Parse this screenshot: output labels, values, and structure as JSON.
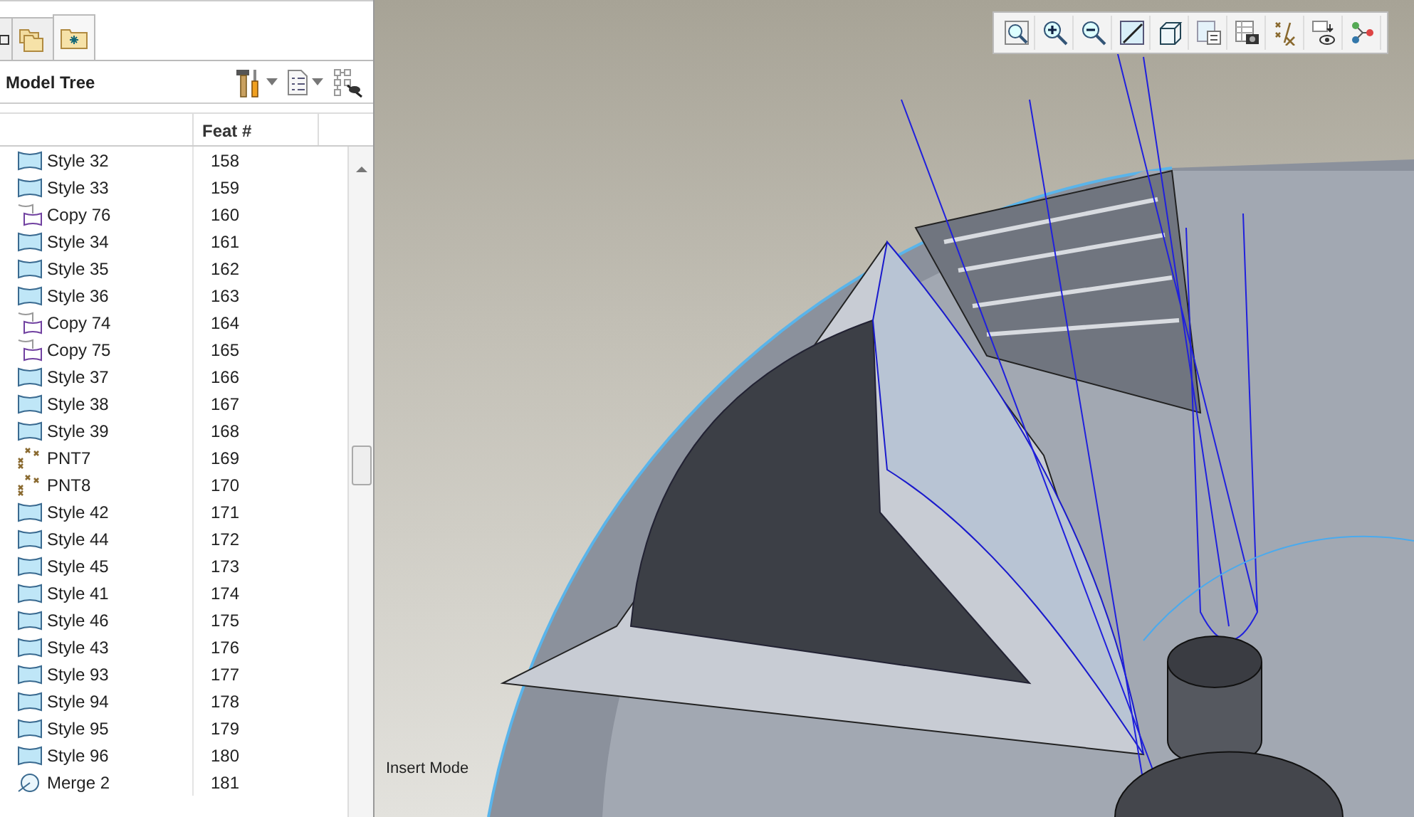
{
  "tabs": [
    {
      "kind": "tree",
      "selected": false
    },
    {
      "kind": "folders",
      "selected": false
    },
    {
      "kind": "favorites",
      "selected": true
    }
  ],
  "model_tree": {
    "title": "Model Tree",
    "columns": [
      "",
      "Feat #"
    ],
    "rows": [
      {
        "kind": "style",
        "name": "Style 32",
        "feat": "158"
      },
      {
        "kind": "style",
        "name": "Style 33",
        "feat": "159"
      },
      {
        "kind": "copy",
        "name": "Copy 76",
        "feat": "160"
      },
      {
        "kind": "style",
        "name": "Style 34",
        "feat": "161"
      },
      {
        "kind": "style",
        "name": "Style 35",
        "feat": "162"
      },
      {
        "kind": "style",
        "name": "Style 36",
        "feat": "163"
      },
      {
        "kind": "copy",
        "name": "Copy 74",
        "feat": "164"
      },
      {
        "kind": "copy",
        "name": "Copy 75",
        "feat": "165"
      },
      {
        "kind": "style",
        "name": "Style 37",
        "feat": "166"
      },
      {
        "kind": "style",
        "name": "Style 38",
        "feat": "167"
      },
      {
        "kind": "style",
        "name": "Style 39",
        "feat": "168"
      },
      {
        "kind": "point",
        "name": "PNT7",
        "feat": "169"
      },
      {
        "kind": "point",
        "name": "PNT8",
        "feat": "170"
      },
      {
        "kind": "style",
        "name": "Style 42",
        "feat": "171"
      },
      {
        "kind": "style",
        "name": "Style 44",
        "feat": "172"
      },
      {
        "kind": "style",
        "name": "Style 45",
        "feat": "173"
      },
      {
        "kind": "style",
        "name": "Style 41",
        "feat": "174"
      },
      {
        "kind": "style",
        "name": "Style 46",
        "feat": "175"
      },
      {
        "kind": "style",
        "name": "Style 43",
        "feat": "176"
      },
      {
        "kind": "style",
        "name": "Style 93",
        "feat": "177"
      },
      {
        "kind": "style",
        "name": "Style 94",
        "feat": "178"
      },
      {
        "kind": "style",
        "name": "Style 95",
        "feat": "179"
      },
      {
        "kind": "style",
        "name": "Style 96",
        "feat": "180"
      },
      {
        "kind": "merge",
        "name": "Merge 2",
        "feat": "181"
      }
    ]
  },
  "graphics": {
    "status": "Insert Mode"
  }
}
